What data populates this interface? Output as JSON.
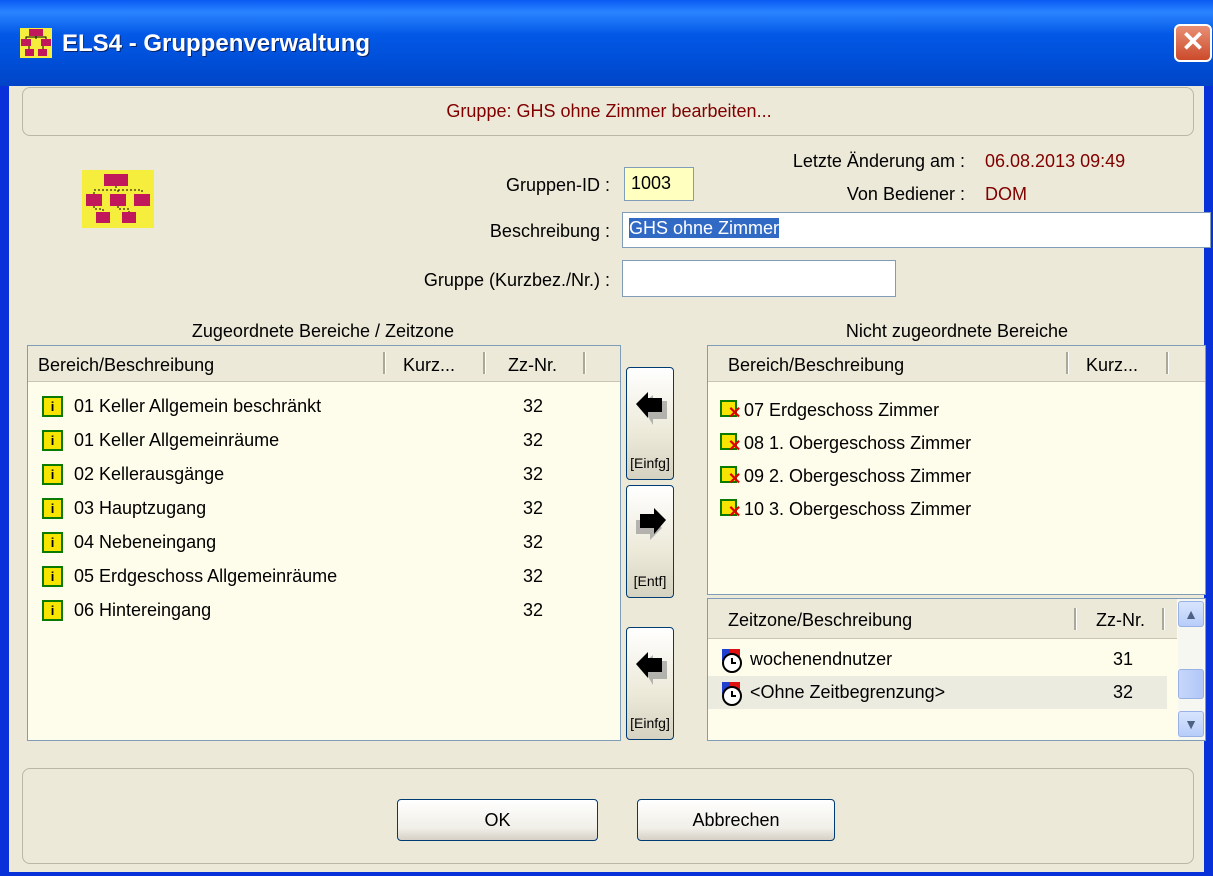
{
  "window": {
    "title": "ELS4 - Gruppenverwaltung",
    "close_glyph": "✕"
  },
  "header": {
    "text": "Gruppe: GHS ohne Zimmer bearbeiten..."
  },
  "form": {
    "group_id_label": "Gruppen-ID :",
    "group_id_value": "1003",
    "last_change_label": "Letzte Änderung am :",
    "last_change_value": "06.08.2013 09:49",
    "operator_label": "Von Bediener :",
    "operator_value": "DOM",
    "description_label": "Beschreibung :",
    "description_value": "GHS ohne Zimmer",
    "group_short_label": "Gruppe (Kurzbez./Nr.) :",
    "group_short_value": ""
  },
  "assigned": {
    "title": "Zugeordnete Bereiche / Zeitzone",
    "columns": [
      "Bereich/Beschreibung",
      "Kurz...",
      "Zz-Nr."
    ],
    "rows": [
      {
        "name": "01 Keller Allgemein beschränkt",
        "zz": "32"
      },
      {
        "name": "01 Keller Allgemeinräume",
        "zz": "32"
      },
      {
        "name": "02 Kellerausgänge",
        "zz": "32"
      },
      {
        "name": "03 Hauptzugang",
        "zz": "32"
      },
      {
        "name": "04 Nebeneingang",
        "zz": "32"
      },
      {
        "name": "05 Erdgeschoss Allgemeinräume",
        "zz": "32"
      },
      {
        "name": "06 Hintereingang",
        "zz": "32"
      }
    ]
  },
  "unassigned": {
    "title": "Nicht zugeordnete Bereiche",
    "columns": [
      "Bereich/Beschreibung",
      "Kurz..."
    ],
    "rows": [
      {
        "name": "07 Erdgeschoss Zimmer"
      },
      {
        "name": "08 1. Obergeschoss Zimmer"
      },
      {
        "name": "09 2. Obergeschoss Zimmer"
      },
      {
        "name": "10 3. Obergeschoss Zimmer"
      }
    ]
  },
  "timezones": {
    "columns": [
      "Zeitzone/Beschreibung",
      "Zz-Nr."
    ],
    "rows": [
      {
        "name": "wochenendnutzer",
        "zz": "31"
      },
      {
        "name": "<Ohne Zeitbegrenzung>",
        "zz": "32"
      }
    ]
  },
  "buttons": {
    "insert": "[Einfg]",
    "remove": "[Entf]",
    "insert_tz": "[Einfg]",
    "ok": "OK",
    "cancel": "Abbrechen"
  },
  "colors": {
    "accent": "#0831d9",
    "dark_red": "#800000",
    "field_yellow": "#ffffc0",
    "list_bg": "#fefcea"
  }
}
